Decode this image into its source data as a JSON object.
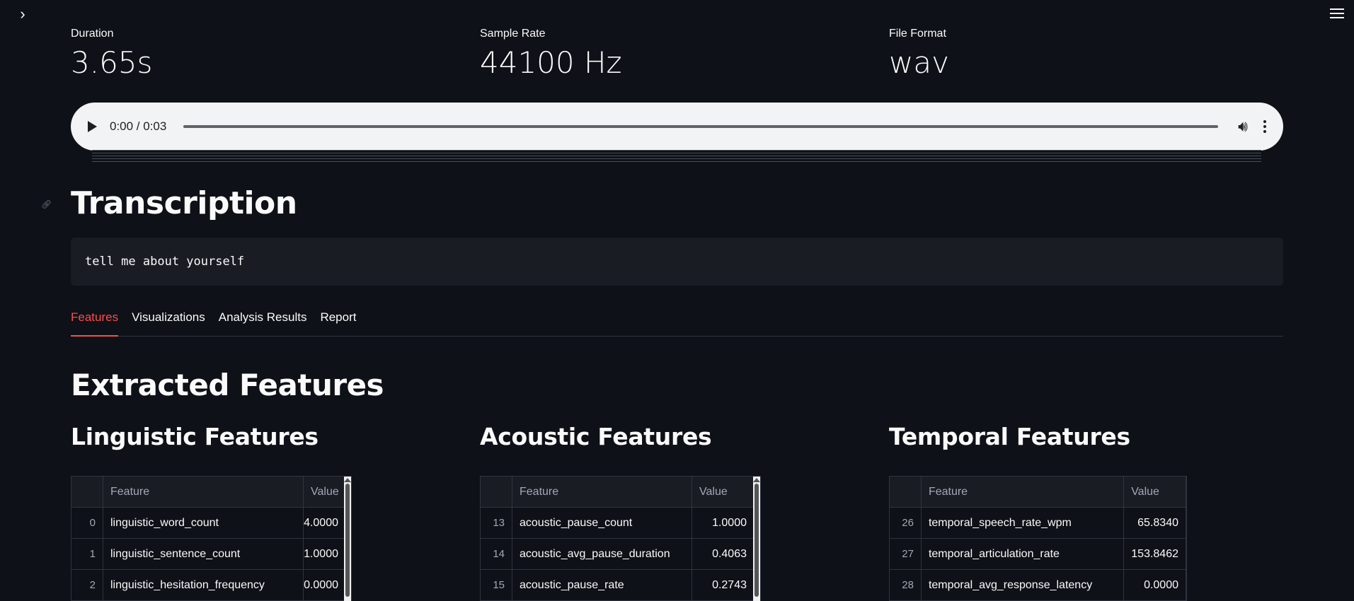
{
  "metrics": [
    {
      "label": "Duration",
      "value": "3.65s"
    },
    {
      "label": "Sample Rate",
      "value": "44100 Hz"
    },
    {
      "label": "File Format",
      "value": "wav"
    }
  ],
  "audio": {
    "time": "0:00 / 0:03",
    "progress": 0
  },
  "transcription": {
    "heading": "Transcription",
    "text": "tell me about yourself"
  },
  "tabs": [
    {
      "label": "Features",
      "active": true
    },
    {
      "label": "Visualizations",
      "active": false
    },
    {
      "label": "Analysis Results",
      "active": false
    },
    {
      "label": "Report",
      "active": false
    }
  ],
  "extracted_heading": "Extracted Features",
  "tables": [
    {
      "title": "Linguistic Features",
      "columns": [
        "",
        "Feature",
        "Value"
      ],
      "rows": [
        [
          "0",
          "linguistic_word_count",
          "4.0000"
        ],
        [
          "1",
          "linguistic_sentence_count",
          "1.0000"
        ],
        [
          "2",
          "linguistic_hesitation_frequency",
          "0.0000"
        ]
      ]
    },
    {
      "title": "Acoustic Features",
      "columns": [
        "",
        "Feature",
        "Value"
      ],
      "rows": [
        [
          "13",
          "acoustic_pause_count",
          "1.0000"
        ],
        [
          "14",
          "acoustic_avg_pause_duration",
          "0.4063"
        ],
        [
          "15",
          "acoustic_pause_rate",
          "0.2743"
        ]
      ]
    },
    {
      "title": "Temporal Features",
      "columns": [
        "",
        "Feature",
        "Value"
      ],
      "rows": [
        [
          "26",
          "temporal_speech_rate_wpm",
          "65.8340"
        ],
        [
          "27",
          "temporal_articulation_rate",
          "153.8462"
        ],
        [
          "28",
          "temporal_avg_response_latency",
          "0.0000"
        ]
      ]
    }
  ],
  "colors": {
    "background": "#0e1117",
    "accent": "#ff4b4b",
    "code_bg": "#1a1c24",
    "border": "#31333f"
  },
  "icons": {
    "sidebar": "chevron-right-icon",
    "menu": "hamburger-menu-icon",
    "play": "play-icon",
    "volume": "volume-icon",
    "more": "more-vertical-icon",
    "anchor": "link-icon"
  }
}
